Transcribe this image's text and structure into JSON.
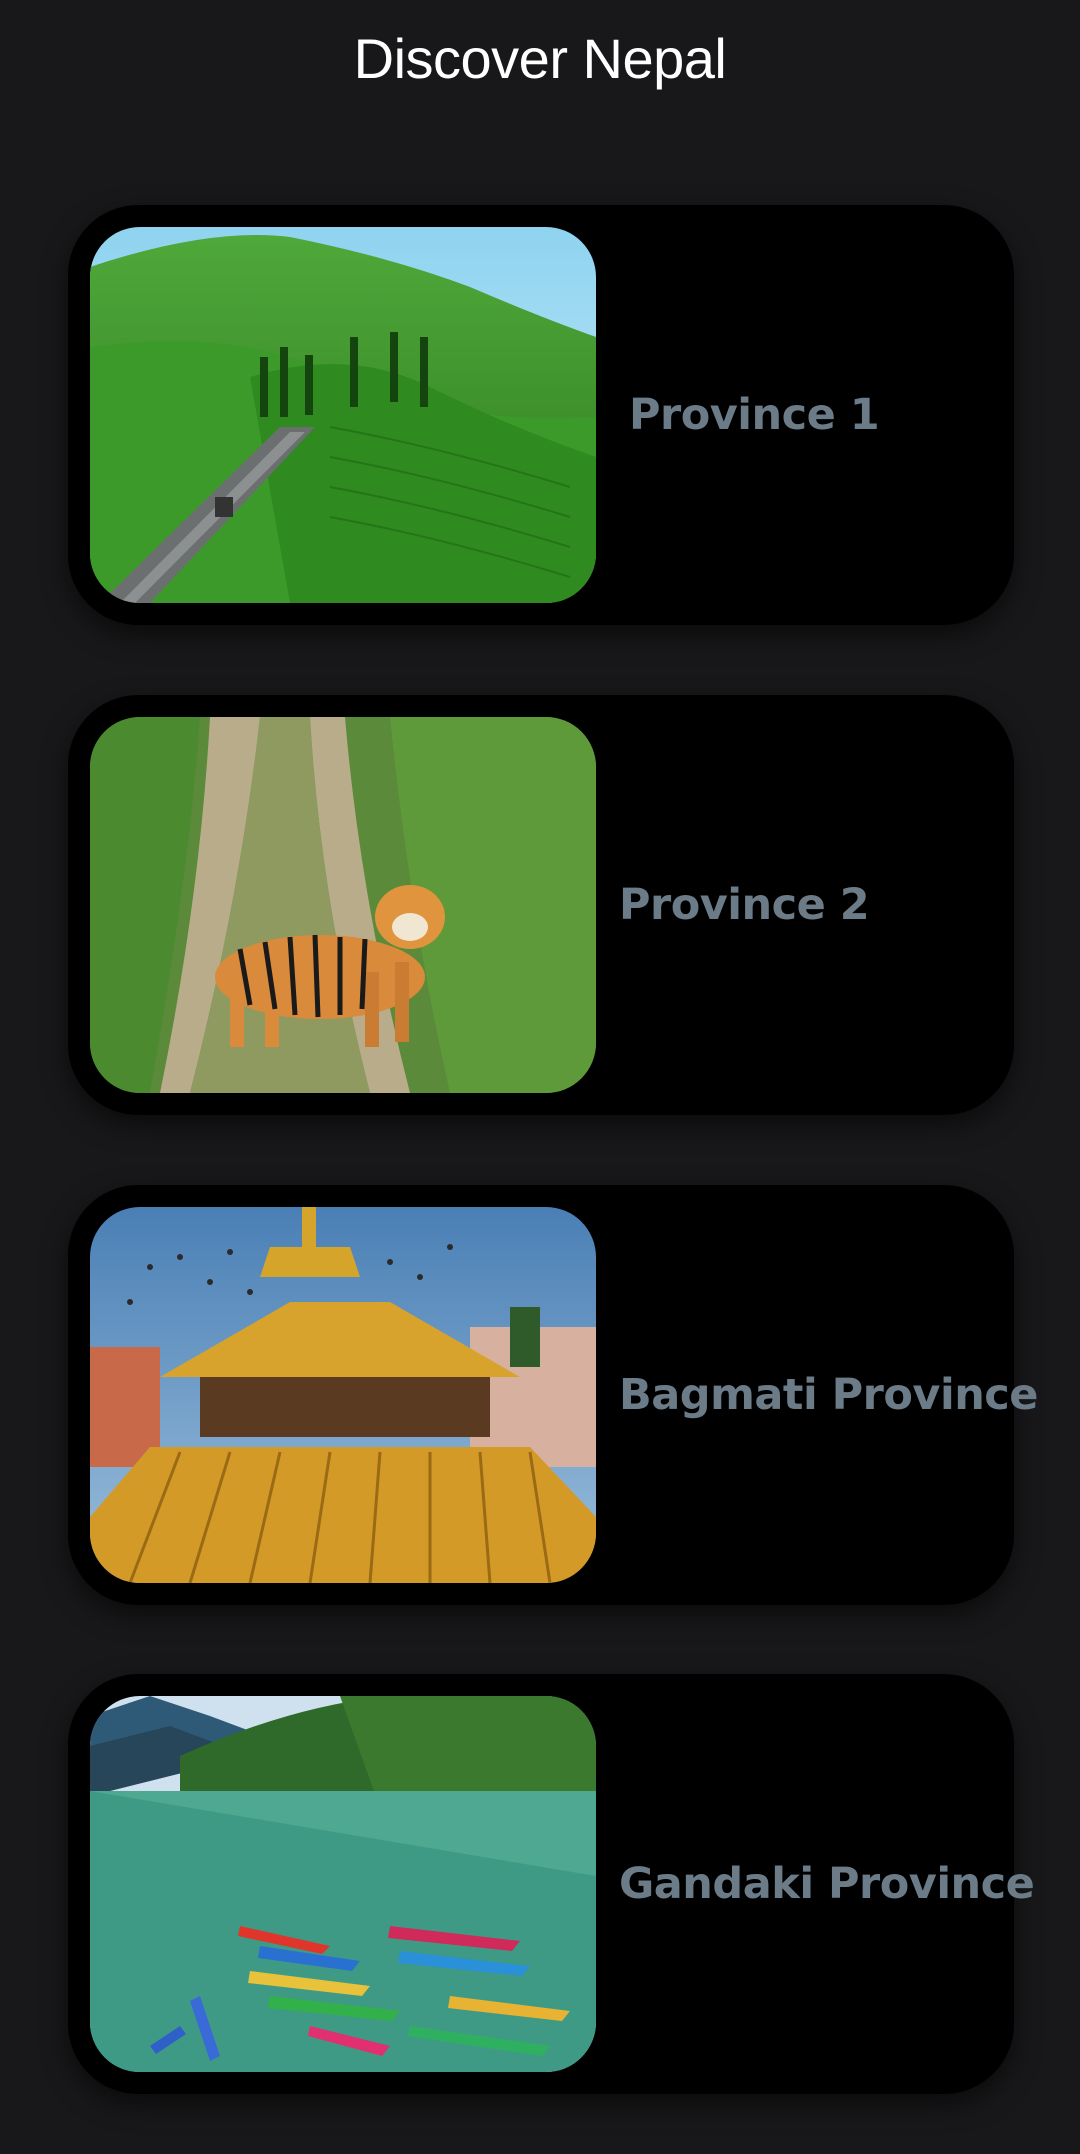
{
  "header": {
    "title": "Discover Nepal"
  },
  "provinces": [
    {
      "label": "Province 1",
      "image": "tea-garden-hills-photo"
    },
    {
      "label": "Province 2",
      "image": "tiger-on-trail-photo"
    },
    {
      "label": "Bagmati Province",
      "image": "pagoda-temple-pigeons-photo"
    },
    {
      "label": "Gandaki Province",
      "image": "lake-boats-photo"
    }
  ],
  "colors": {
    "background": "#18181a",
    "card": "#000000",
    "label": "#6b7c88",
    "title": "#ffffff"
  }
}
